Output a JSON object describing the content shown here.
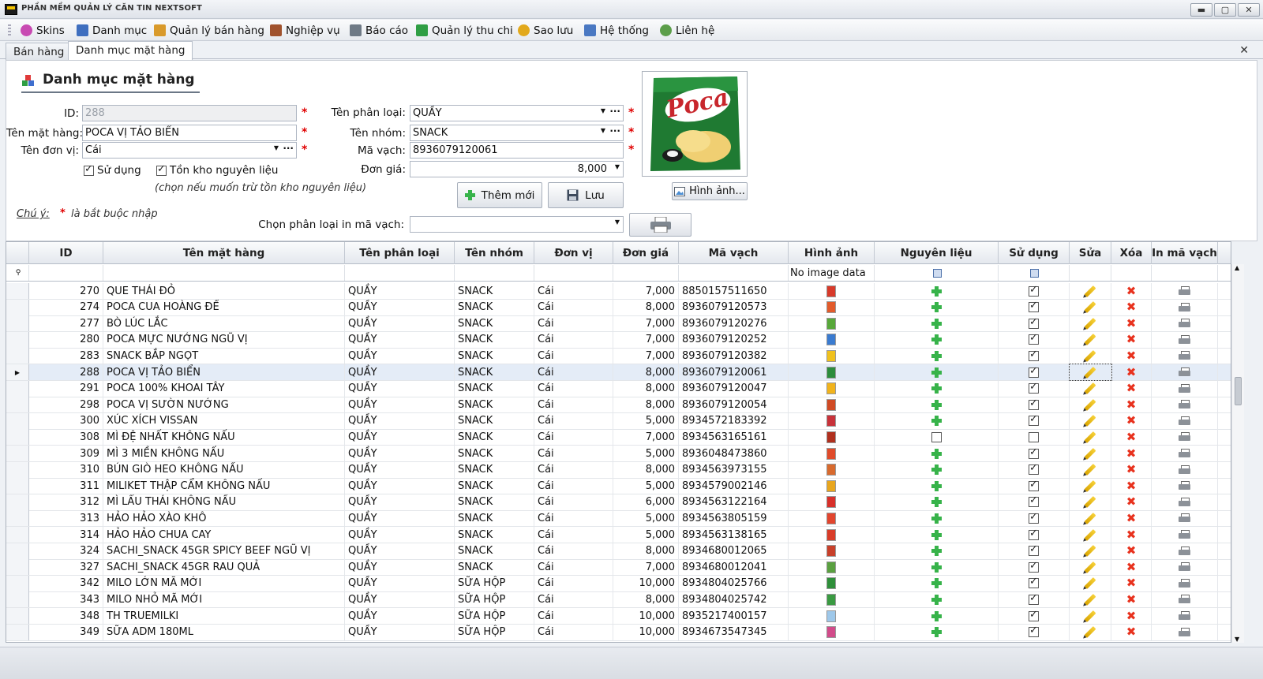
{
  "app": {
    "title": "PHẦN MỀM QUẢN LÝ CĂN TIN NEXTSOFT"
  },
  "menu": [
    {
      "label": "Skins",
      "icon": "palette-icon",
      "color": "#c84ab2"
    },
    {
      "label": "Danh mục",
      "icon": "grid-icon",
      "color": "#3f6fbf"
    },
    {
      "label": "Quản lý bán hàng",
      "icon": "box-icon",
      "color": "#d99a2b"
    },
    {
      "label": "Nghiệp vụ",
      "icon": "briefcase-icon",
      "color": "#a0522d"
    },
    {
      "label": "Báo cáo",
      "icon": "clipboard-icon",
      "color": "#6f7a86"
    },
    {
      "label": "Quản lý thu chi",
      "icon": "money-icon",
      "color": "#2f9e44"
    },
    {
      "label": "Sao lưu",
      "icon": "database-icon",
      "color": "#e2a91c"
    },
    {
      "label": "Hệ thống",
      "icon": "gear-icon",
      "color": "#4a78c2"
    },
    {
      "label": "Liên hệ",
      "icon": "person-icon",
      "color": "#5c9e4a"
    }
  ],
  "tabs": [
    {
      "label": "Bán hàng"
    },
    {
      "label": "Danh mục mặt hàng"
    }
  ],
  "form": {
    "heading": "Danh mục mặt hàng",
    "id_label": "ID:",
    "id_value": "288",
    "name_label": "Tên mặt hàng:",
    "name_value": "POCA VỊ TẢO BIỂN",
    "unit_label": "Tên đơn vị:",
    "unit_value": "Cái",
    "category_label": "Tên phân loại:",
    "category_value": "QUẦY",
    "group_label": "Tên nhóm:",
    "group_value": "SNACK",
    "barcode_label": "Mã vạch:",
    "barcode_value": "8936079120061",
    "price_label": "Đơn giá:",
    "price_value": "8,000",
    "use_label": "Sử dụng",
    "use_checked": true,
    "stock_label": "Tồn kho nguyên liệu",
    "stock_checked": true,
    "stock_note": "(chọn nếu muốn trừ tồn kho nguyên liệu)",
    "note_label": "Chú ý:",
    "note_star": "*",
    "note_text": "là bắt buộc nhập",
    "required_mark": "*",
    "add_button": "Thêm mới",
    "save_button": "Lưu",
    "image_button": "Hình ảnh...",
    "print_category_label": "Chọn phân loại in mã vạch:",
    "print_category_value": "",
    "photo_brand": "Poca"
  },
  "grid": {
    "columns": [
      "ID",
      "Tên mặt hàng",
      "Tên phân loại",
      "Tên nhóm",
      "Đơn vị",
      "Đơn giá",
      "Mã vạch",
      "Hình ảnh",
      "Nguyên liệu",
      "Sử dụng",
      "Sửa",
      "Xóa",
      "In mã vạch"
    ],
    "filter_image_text": "No image data",
    "rows": [
      {
        "id": "270",
        "name": "QUE THÁI ĐỎ",
        "cat": "QUẦY",
        "group": "SNACK",
        "unit": "Cái",
        "price": "7,000",
        "barcode": "8850157511650",
        "thumb": "#d83a2a",
        "mat": true,
        "use": true
      },
      {
        "id": "274",
        "name": "POCA CUA HOÀNG ĐẾ",
        "cat": "QUẦY",
        "group": "SNACK",
        "unit": "Cái",
        "price": "8,000",
        "barcode": "8936079120573",
        "thumb": "#e25b2b",
        "mat": true,
        "use": true
      },
      {
        "id": "277",
        "name": "BÒ LÚC LẮC",
        "cat": "QUẦY",
        "group": "SNACK",
        "unit": "Cái",
        "price": "7,000",
        "barcode": "8936079120276",
        "thumb": "#58a83a",
        "mat": true,
        "use": true
      },
      {
        "id": "280",
        "name": "POCA MỰC NƯỚNG NGŨ VỊ",
        "cat": "QUẦY",
        "group": "SNACK",
        "unit": "Cái",
        "price": "7,000",
        "barcode": "8936079120252",
        "thumb": "#3a7bd0",
        "mat": true,
        "use": true
      },
      {
        "id": "283",
        "name": "SNACK BẮP NGỌT",
        "cat": "QUẦY",
        "group": "SNACK",
        "unit": "Cái",
        "price": "7,000",
        "barcode": "8936079120382",
        "thumb": "#f0c11d",
        "mat": true,
        "use": true
      },
      {
        "id": "288",
        "name": "POCA VỊ TẢO BIỂN",
        "cat": "QUẦY",
        "group": "SNACK",
        "unit": "Cái",
        "price": "8,000",
        "barcode": "8936079120061",
        "thumb": "#2c8c3c",
        "mat": true,
        "use": true,
        "selected": true
      },
      {
        "id": "291",
        "name": "POCA 100% KHOAI TÂY",
        "cat": "QUẦY",
        "group": "SNACK",
        "unit": "Cái",
        "price": "8,000",
        "barcode": "8936079120047",
        "thumb": "#f1b31c",
        "mat": true,
        "use": true
      },
      {
        "id": "298",
        "name": "POCA VỊ SƯỜN NƯỚNG",
        "cat": "QUẦY",
        "group": "SNACK",
        "unit": "Cái",
        "price": "8,000",
        "barcode": "8936079120054",
        "thumb": "#d04a24",
        "mat": true,
        "use": true
      },
      {
        "id": "300",
        "name": "XÚC XÍCH VISSAN",
        "cat": "QUẦY",
        "group": "SNACK",
        "unit": "Cái",
        "price": "5,000",
        "barcode": "8934572183392",
        "thumb": "#c8323a",
        "mat": true,
        "use": true
      },
      {
        "id": "308",
        "name": "MÌ ĐỆ NHẤT KHÔNG NẤU",
        "cat": "QUẦY",
        "group": "SNACK",
        "unit": "Cái",
        "price": "7,000",
        "barcode": "8934563165161",
        "thumb": "#b0301e",
        "mat": false,
        "use": false
      },
      {
        "id": "309",
        "name": "MÌ 3 MIỀN KHÔNG NẤU",
        "cat": "QUẦY",
        "group": "SNACK",
        "unit": "Cái",
        "price": "5,000",
        "barcode": "8936048473860",
        "thumb": "#e04b2a",
        "mat": true,
        "use": true
      },
      {
        "id": "310",
        "name": "BÚN GIÒ HEO KHÔNG NẤU",
        "cat": "QUẦY",
        "group": "SNACK",
        "unit": "Cái",
        "price": "8,000",
        "barcode": "8934563973155",
        "thumb": "#d86a2e",
        "mat": true,
        "use": true
      },
      {
        "id": "311",
        "name": "MILIKET THẬP CẨM KHÔNG NẤU",
        "cat": "QUẦY",
        "group": "SNACK",
        "unit": "Cái",
        "price": "5,000",
        "barcode": "8934579002146",
        "thumb": "#e8a61e",
        "mat": true,
        "use": true
      },
      {
        "id": "312",
        "name": "MÌ LẨU THÁI KHÔNG NẤU",
        "cat": "QUẦY",
        "group": "SNACK",
        "unit": "Cái",
        "price": "6,000",
        "barcode": "8934563122164",
        "thumb": "#d8302a",
        "mat": true,
        "use": true
      },
      {
        "id": "313",
        "name": "HẢO HẢO XÀO KHÔ",
        "cat": "QUẦY",
        "group": "SNACK",
        "unit": "Cái",
        "price": "5,000",
        "barcode": "8934563805159",
        "thumb": "#e2452e",
        "mat": true,
        "use": true
      },
      {
        "id": "314",
        "name": "HẢO HẢO CHUA CAY",
        "cat": "QUẦY",
        "group": "SNACK",
        "unit": "Cái",
        "price": "5,000",
        "barcode": "8934563138165",
        "thumb": "#d93c28",
        "mat": true,
        "use": true
      },
      {
        "id": "324",
        "name": "SACHI_SNACK 45GR SPICY BEEF NGŨ VỊ",
        "cat": "QUẦY",
        "group": "SNACK",
        "unit": "Cái",
        "price": "8,000",
        "barcode": "8934680012065",
        "thumb": "#c8402a",
        "mat": true,
        "use": true
      },
      {
        "id": "327",
        "name": "SACHI_SNACK 45GR RAU QUẢ",
        "cat": "QUẦY",
        "group": "SNACK",
        "unit": "Cái",
        "price": "7,000",
        "barcode": "8934680012041",
        "thumb": "#5aa040",
        "mat": true,
        "use": true
      },
      {
        "id": "342",
        "name": "MILO LỚN MÃ MỚI",
        "cat": "QUẦY",
        "group": "SỮA HỘP",
        "unit": "Cái",
        "price": "10,000",
        "barcode": "8934804025766",
        "thumb": "#2f8f3a",
        "mat": true,
        "use": true
      },
      {
        "id": "343",
        "name": "MILO NHỎ MÃ MỚI",
        "cat": "QUẦY",
        "group": "SỮA HỘP",
        "unit": "Cái",
        "price": "8,000",
        "barcode": "8934804025742",
        "thumb": "#3a9a42",
        "mat": true,
        "use": true
      },
      {
        "id": "348",
        "name": "TH TRUEMILKI",
        "cat": "QUẦY",
        "group": "SỮA HỘP",
        "unit": "Cái",
        "price": "10,000",
        "barcode": "8935217400157",
        "thumb": "#9ec8ea",
        "mat": true,
        "use": true
      },
      {
        "id": "349",
        "name": "SỮA ADM 180ML",
        "cat": "QUẦY",
        "group": "SỮA HỘP",
        "unit": "Cái",
        "price": "10,000",
        "barcode": "8934673547345",
        "thumb": "#d24b8a",
        "mat": true,
        "use": true
      }
    ]
  }
}
